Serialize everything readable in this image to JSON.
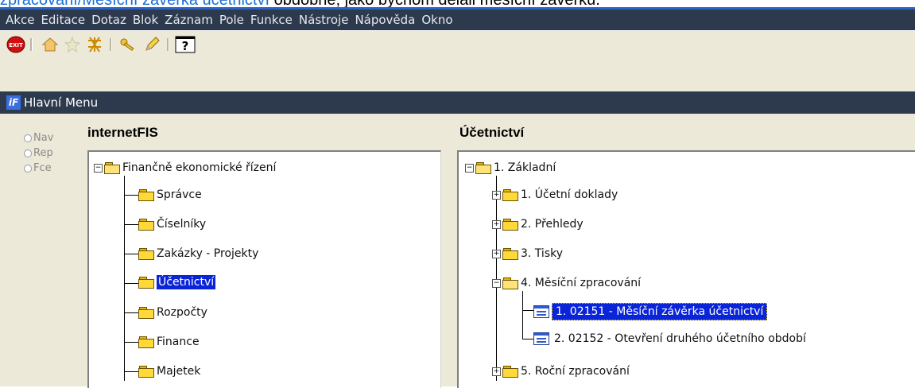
{
  "caption": {
    "link_text": "zpracování/Měsíční závěrka účetnictví",
    "rest_text": " obdobně, jako bychom dělali měsíční závěrku."
  },
  "menu": [
    "Akce",
    "Editace",
    "Dotaz",
    "Blok",
    "Záznam",
    "Pole",
    "Funkce",
    "Nástroje",
    "Nápověda",
    "Okno"
  ],
  "toolbar": {
    "exit_label": "EXIT",
    "help_label": "?"
  },
  "window": {
    "title": "Hlavní Menu",
    "logo": "iF"
  },
  "radios": [
    "Nav",
    "Rep",
    "Fce"
  ],
  "left": {
    "title": "internetFIS",
    "root": "Finančně ekonomické řízení",
    "items": [
      "Správce",
      "Číselníky",
      "Zakázky - Projekty",
      "Účetnictví",
      "Rozpočty",
      "Finance",
      "Majetek"
    ]
  },
  "right": {
    "title": "Účetnictví",
    "root": "1.  Základní",
    "items": [
      "1.  Účetní doklady",
      "2.  Přehledy",
      "3.  Tisky",
      "4.  Měsíční zpracování"
    ],
    "sub": [
      "1.  02151 - Měsíční závěrka účetnictví",
      "2.  02152 - Otevření druhého účetního období"
    ],
    "last": "5.  Roční zpracování"
  },
  "colors": {
    "menubar": "#2d3a4e",
    "selection": "#0a24d8",
    "link": "#1a6fd8"
  }
}
